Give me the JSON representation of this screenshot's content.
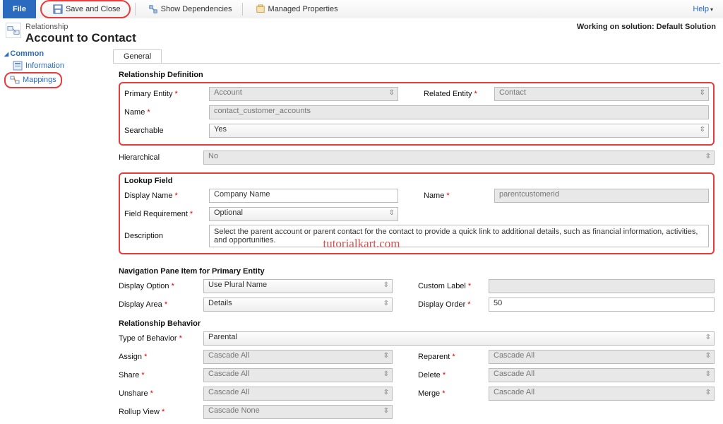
{
  "toolbar": {
    "file": "File",
    "save_close": "Save and Close",
    "show_deps": "Show Dependencies",
    "managed_props": "Managed Properties",
    "help": "Help"
  },
  "header": {
    "sub": "Relationship",
    "title": "Account to Contact",
    "working_on": "Working on solution: Default Solution"
  },
  "sidebar": {
    "group": "Common",
    "items": [
      {
        "label": "Information"
      },
      {
        "label": "Mappings"
      }
    ]
  },
  "tabs": {
    "general": "General"
  },
  "relationship_definition": {
    "title": "Relationship Definition",
    "primary_entity_label": "Primary Entity",
    "primary_entity_value": "Account",
    "related_entity_label": "Related Entity",
    "related_entity_value": "Contact",
    "name_label": "Name",
    "name_value": "contact_customer_accounts",
    "searchable_label": "Searchable",
    "searchable_value": "Yes",
    "hierarchical_label": "Hierarchical",
    "hierarchical_value": "No"
  },
  "lookup_field": {
    "title": "Lookup Field",
    "display_name_label": "Display Name",
    "display_name_value": "Company Name",
    "name_label": "Name",
    "name_value": "parentcustomerid",
    "field_requirement_label": "Field Requirement",
    "field_requirement_value": "Optional",
    "description_label": "Description",
    "description_value": "Select the parent account or parent contact for the contact to provide a quick link to additional details, such as financial information, activities, and opportunities."
  },
  "nav_pane": {
    "title": "Navigation Pane Item for Primary Entity",
    "display_option_label": "Display Option",
    "display_option_value": "Use Plural Name",
    "custom_label_label": "Custom Label",
    "custom_label_value": "",
    "display_area_label": "Display Area",
    "display_area_value": "Details",
    "display_order_label": "Display Order",
    "display_order_value": "50"
  },
  "relationship_behavior": {
    "title": "Relationship Behavior",
    "type_label": "Type of Behavior",
    "type_value": "Parental",
    "assign_label": "Assign",
    "assign_value": "Cascade All",
    "reparent_label": "Reparent",
    "reparent_value": "Cascade All",
    "share_label": "Share",
    "share_value": "Cascade All",
    "delete_label": "Delete",
    "delete_value": "Cascade All",
    "unshare_label": "Unshare",
    "unshare_value": "Cascade All",
    "merge_label": "Merge",
    "merge_value": "Cascade All",
    "rollup_label": "Rollup View",
    "rollup_value": "Cascade None"
  },
  "watermark": "tutorialkart.com"
}
